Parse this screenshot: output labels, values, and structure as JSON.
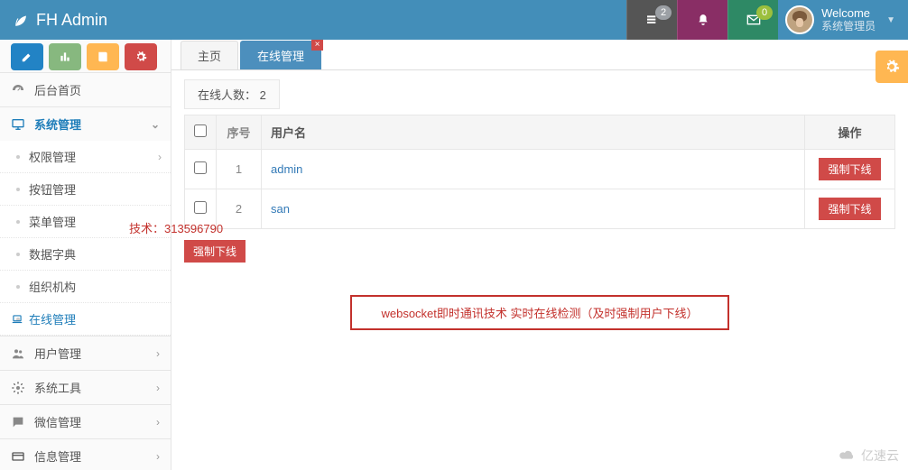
{
  "header": {
    "brand": "FH Admin",
    "notif_badge": "2",
    "mail_badge": "0",
    "welcome": "Welcome",
    "user_role": "系统管理员"
  },
  "sidebar": {
    "home": "后台首页",
    "sys": "系统管理",
    "perm": "权限管理",
    "btn": "按钮管理",
    "menu": "菜单管理",
    "dict": "数据字典",
    "org": "组织机构",
    "online": "在线管理",
    "user": "用户管理",
    "tool": "系统工具",
    "wx": "微信管理",
    "info": "信息管理",
    "contact": "技术：313596790"
  },
  "tabs": {
    "home": "主页",
    "online": "在线管理"
  },
  "content": {
    "summary_label": "在线人数：",
    "summary_count": "2",
    "col_serial": "序号",
    "col_user": "用户名",
    "col_action": "操作",
    "kick_label": "强制下线",
    "rows": [
      {
        "n": "1",
        "user": "admin"
      },
      {
        "n": "2",
        "user": "san"
      }
    ],
    "note": "websocket即时通讯技术    实时在线检测（及时强制用户下线）"
  },
  "watermark": "亿速云"
}
